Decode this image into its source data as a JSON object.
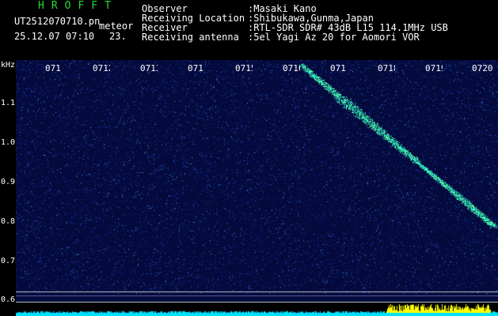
{
  "header": {
    "title": "HROFFT",
    "filename": "UT2512070710.pn",
    "kind": "meteor",
    "datetime": "25.12.07 07:10",
    "number": "23.",
    "info": [
      {
        "label": "Observer",
        "value": ":Masaki Kano"
      },
      {
        "label": "Receiving Location",
        "value": ":Shibukawa,Gunma,Japan"
      },
      {
        "label": "Receiver",
        "value": ":RTL-SDR SDR# 43dB L15 114.1MHz USB"
      },
      {
        "label": "Receiving antenna",
        "value": ":5el Yagi Az 20 for Aomori VOR"
      }
    ]
  },
  "spectrogram": {
    "y_unit": "kHz",
    "y_ticks": [
      "1.1",
      "1.0",
      "0.9",
      "0.8",
      "0.7",
      "0.6"
    ],
    "x_ticks": [
      "071",
      "0712",
      "0713",
      "071",
      "0715",
      "0716",
      "071",
      "0718",
      "0719",
      "0720"
    ],
    "background_color": "#050a3c",
    "meteor_color": "#33ffcc",
    "level_bar_color": "#00e0ff",
    "level_peak_color": "#ffff00"
  }
}
